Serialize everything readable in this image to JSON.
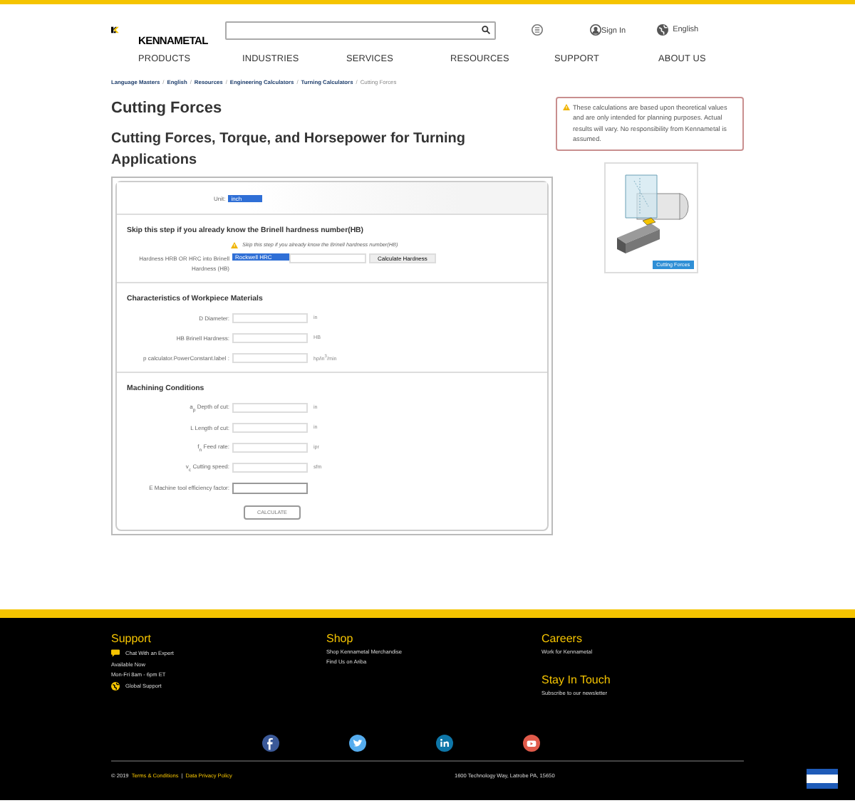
{
  "header": {
    "logo_text": "KENNAMETAL",
    "sign_in": "Sign In",
    "language": "English"
  },
  "breadcrumb_separator": "/",
  "nav": [
    "PRODUCTS",
    "INDUSTRIES",
    "SERVICES",
    "RESOURCES",
    "SUPPORT",
    "ABOUT US"
  ],
  "breadcrumb": [
    {
      "label": "Language Masters",
      "current": false
    },
    {
      "label": "English",
      "current": false
    },
    {
      "label": "Resources",
      "current": false
    },
    {
      "label": "Engineering Calculators",
      "current": false
    },
    {
      "label": "Turning Calculators",
      "current": false
    },
    {
      "label": "Cutting Forces",
      "current": true
    }
  ],
  "title": "Cutting Forces",
  "subtitle": "Cutting Forces, Torque, and Horsepower for Turning Applications",
  "notice": "These calculations are based upon theoretical values and are only intended for planning purposes. Actual results will vary. No responsibility from Kennametal is assumed.",
  "image_caption": "Cutting Forces",
  "form": {
    "unit_label": "Unit:",
    "unit_value": "inch",
    "skip_heading": "Skip this step if you already know the Brinell hardness number(HB)",
    "skip_note": "Skip this step if you already know the Brinell hardness number(HB)",
    "hardness_label": "Hardness HRB OR HRC into Brinell Hardness (HB)",
    "hardness_value": "Rockwell HRC",
    "hardness_button": "Calculate Hardness",
    "sections": [
      {
        "heading": "Characteristics of Workpiece Materials",
        "fields": [
          {
            "label": "D Diameter:",
            "unit": "in"
          },
          {
            "label": "HB Brinell Hardness:",
            "unit": "HB"
          },
          {
            "label": "p calculator.PowerConstant.label :",
            "unit": "hp/in$^{3}$/min"
          }
        ]
      },
      {
        "heading": "Machining Conditions",
        "fields": [
          {
            "label": "a$_{p}$ Depth of cut:",
            "unit": "in"
          },
          {
            "label": "L Length of cut:",
            "unit": "in"
          },
          {
            "label": "f$_{n}$ Feed rate:",
            "unit": "ipr"
          },
          {
            "label": "v$_{c}$ Cutting speed:",
            "unit": "sfm"
          },
          {
            "label": "E Machine tool efficiency factor:"
          }
        ]
      }
    ],
    "submit": "CALCULATE"
  },
  "footer": {
    "columns": [
      {
        "groups": [
          {
            "heading": "Support",
            "links": [
              {
                "label": "Chat With an Expert",
                "kind": "chat"
              },
              {
                "label": "Available Now"
              },
              {
                "label": "Mon-Fri 8am - 6pm ET"
              },
              {
                "label": "Global Support",
                "kind": "globe"
              }
            ]
          }
        ]
      },
      {
        "groups": [
          {
            "heading": "Shop",
            "links": [
              {
                "label": "Shop Kennametal Merchandise"
              },
              {
                "label": "Find Us on Ariba"
              }
            ]
          }
        ]
      },
      {
        "groups": [
          {
            "heading": "Careers",
            "links": [
              {
                "label": "Work for Kennametal"
              }
            ]
          },
          {
            "heading": "Stay In Touch",
            "links": [
              {
                "label": "Subscribe to our newsletter"
              }
            ]
          }
        ]
      }
    ],
    "social": [
      {
        "kind": "facebook",
        "color": "#3b5998"
      },
      {
        "kind": "twitter",
        "color": "#55acee"
      },
      {
        "kind": "linkedin",
        "color": "#0e76a8"
      },
      {
        "kind": "youtube",
        "color": "#e05a4a"
      }
    ],
    "copyright": "© 2019",
    "terms": "Terms & Conditions",
    "separator": "|",
    "privacy": "Data Privacy Policy",
    "address": "1600 Technology Way, Latrobe PA, 15650"
  }
}
